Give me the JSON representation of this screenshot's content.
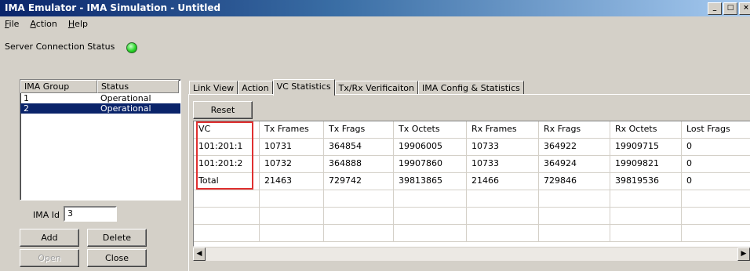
{
  "window": {
    "title": "IMA Emulator - IMA Simulation - Untitled",
    "controls": [
      "_",
      "□",
      "×"
    ]
  },
  "menu": [
    "File",
    "Action",
    "Help"
  ],
  "server": {
    "label": "Server Connection Status",
    "status_color": "#2bd62b"
  },
  "group_list": {
    "headers": [
      "IMA Group",
      "Status"
    ],
    "rows": [
      {
        "group": "1",
        "status": "Operational",
        "selected": false
      },
      {
        "group": "2",
        "status": "Operational",
        "selected": true
      }
    ]
  },
  "ima_id": {
    "label": "IMA Id",
    "value": "3"
  },
  "buttons": {
    "add": "Add",
    "delete": "Delete",
    "open": "Open",
    "close": "Close",
    "reset": "Reset"
  },
  "tabs": [
    {
      "label": "Link View",
      "active": false
    },
    {
      "label": "Action",
      "active": false
    },
    {
      "label": "VC Statistics",
      "active": true
    },
    {
      "label": "Tx/Rx Verificaiton",
      "active": false
    },
    {
      "label": "IMA Config & Statistics",
      "active": false
    }
  ],
  "vc_table": {
    "columns": [
      "VC",
      "Tx Frames",
      "Tx Frags",
      "Tx Octets",
      "Rx Frames",
      "Rx Frags",
      "Rx Octets",
      "Lost Frags"
    ],
    "rows": [
      [
        "101:201:1",
        "10731",
        "364854",
        "19906005",
        "10733",
        "364922",
        "19909715",
        "0"
      ],
      [
        "101:201:2",
        "10732",
        "364888",
        "19907860",
        "10733",
        "364924",
        "19909821",
        "0"
      ],
      [
        "Total",
        "21463",
        "729742",
        "39813865",
        "21466",
        "729846",
        "39819536",
        "0"
      ]
    ],
    "empty_rows": 3
  }
}
